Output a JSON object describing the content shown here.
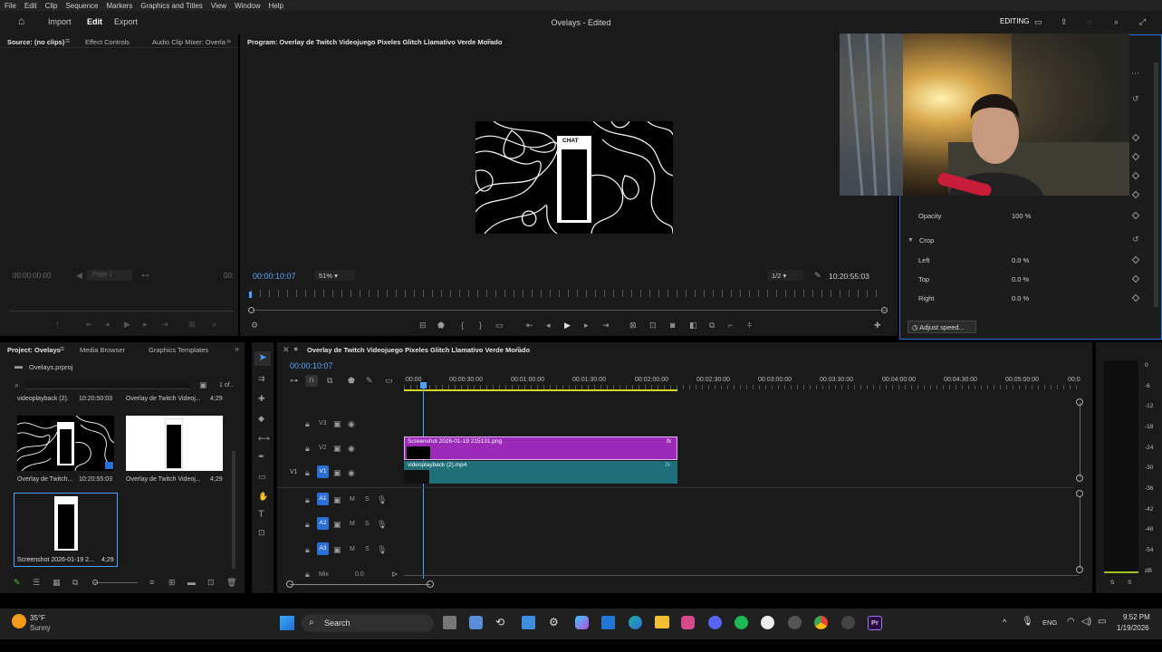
{
  "menu": [
    "File",
    "Edit",
    "Clip",
    "Sequence",
    "Markers",
    "Graphics and Titles",
    "View",
    "Window",
    "Help"
  ],
  "header": {
    "import": "Import",
    "edit": "Edit",
    "export": "Export",
    "title": "Ovelays - Edited",
    "workspace": "EDITING"
  },
  "source": {
    "tabs": [
      "Source: (no clips)",
      "Effect Controls",
      "Audio Clip Mixer: Overla"
    ],
    "timecode": "00:00:00:00",
    "page": "Page 1",
    "tc2": "00:"
  },
  "program": {
    "title": "Program: Overlay de Twitch Videojuego Pixeles Glitch Llamativo Verde Morado",
    "timecode": "00:00:10:07",
    "zoom": "51%",
    "quality": "1/2",
    "duration": "10:20:55:03",
    "chat_label": "CHAT"
  },
  "effect_controls": {
    "opacity_label": "Opacity",
    "opacity_value": "100 %",
    "crop_label": "Crop",
    "left_label": "Left",
    "left_value": "0.0 %",
    "top_label": "Top",
    "top_value": "0.0 %",
    "right_label": "Right",
    "right_value": "0.0 %",
    "tooltip": "Adjust speed..."
  },
  "project": {
    "tabs": [
      "Project: Ovelays",
      "Media Browser",
      "Graphics Templates"
    ],
    "file": "Ovelays.prproj",
    "count": "1 of..",
    "items": [
      {
        "name": "videoplayback (2).",
        "dur": "10:20:50:03"
      },
      {
        "name": "Overlay de Twitch Videoj...",
        "dur": "4;29"
      },
      {
        "name": "Overlay de Twitch...",
        "dur": "10:20:55:03"
      },
      {
        "name": "Overlay de Twitch Videoj...",
        "dur": "4;29"
      },
      {
        "name": "Screenshot 2026-01-19 2...",
        "dur": "4;29"
      }
    ]
  },
  "timeline": {
    "title": "Overlay de Twitch Videojuego Pixeles Glitch Llamativo Verde Morado",
    "timecode": "00:00:10:07",
    "ruler": [
      ":00:00",
      "00:00:30:00",
      "00:01:00:00",
      "00:01:30:00",
      "00:02:00:00",
      "00:02:30:00",
      "00:03:00:00",
      "00:03:30:00",
      "00:04:00:00",
      "00:04:30:00",
      "00:05:00:00",
      "00:0"
    ],
    "video_tracks": [
      "V3",
      "V2",
      "V1"
    ],
    "audio_tracks": [
      "A1",
      "A2",
      "A3"
    ],
    "mix_label": "Mix",
    "mix_value": "0.0",
    "clip_v2": "Screenshot 2026-01-19 215131.png",
    "clip_v1": "videoplayback (2).mp4",
    "fx": "fx"
  },
  "meter": {
    "labels": [
      "0",
      "-6",
      "-12",
      "-18",
      "-24",
      "-30",
      "-36",
      "-42",
      "-48",
      "-54",
      "dB"
    ],
    "s1": "S",
    "s2": "S"
  },
  "taskbar": {
    "temp": "35°F",
    "weather": "Sunny",
    "search": "Search",
    "lang": "ENG",
    "time": "9:52 PM",
    "date": "1/19/2026"
  },
  "colors": {
    "accent": "#2a6fd6",
    "clip_purple": "#9b2ab8",
    "clip_teal": "#1f6f78",
    "timecode_blue": "#5aa8ff"
  }
}
